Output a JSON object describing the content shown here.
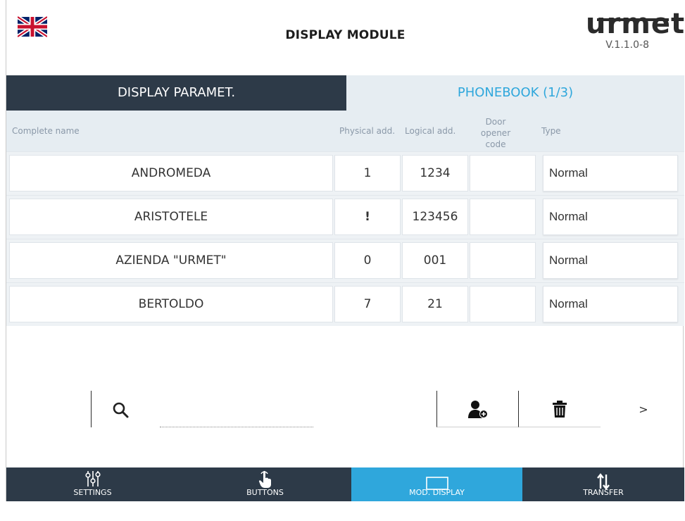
{
  "header": {
    "title": "DISPLAY MODULE",
    "brand": "urmet",
    "version": "V.1.1.0-8"
  },
  "tabs": [
    {
      "label": "DISPLAY PARAMET.",
      "active": true
    },
    {
      "label": "PHONEBOOK (1/3)",
      "active": false
    }
  ],
  "columns": {
    "name": "Complete name",
    "physical": "Physical add.",
    "logical": "Logical add.",
    "door": "Door opener code",
    "type": "Type"
  },
  "rows": [
    {
      "name": "ANDROMEDA",
      "physical": "1",
      "logical": "1234",
      "door": "",
      "type": "Normal"
    },
    {
      "name": "ARISTOTELE",
      "physical": "!",
      "logical": "123456",
      "door": "",
      "type": "Normal"
    },
    {
      "name": "AZIENDA \"URMET\"",
      "physical": "0",
      "logical": "001",
      "door": "",
      "type": "Normal"
    },
    {
      "name": "BERTOLDO",
      "physical": "7",
      "logical": "21",
      "door": "",
      "type": "Normal"
    }
  ],
  "tools": {
    "search_placeholder": "",
    "next_label": ">"
  },
  "nav": [
    {
      "label": "SETTINGS",
      "icon": "sliders-icon",
      "active": false
    },
    {
      "label": "BUTTONS",
      "icon": "hand-pointer-icon",
      "active": false
    },
    {
      "label": "MOD. DISPLAY",
      "icon": "display-icon",
      "active": true
    },
    {
      "label": "TRANSFER",
      "icon": "transfer-arrows-icon",
      "active": false
    }
  ],
  "colors": {
    "dark": "#2d3a48",
    "accent": "#2fa7dc",
    "warning": "#e03a2e",
    "light_bg": "#e6edf2"
  }
}
